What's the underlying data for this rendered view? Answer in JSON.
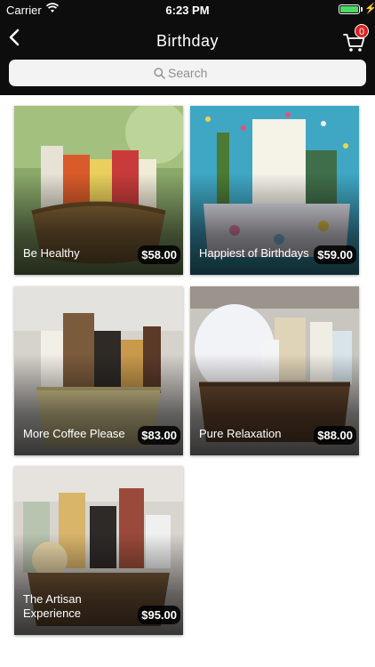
{
  "status_bar": {
    "carrier": "Carrier",
    "time": "6:23 PM",
    "battery_level": 1.0
  },
  "nav": {
    "title": "Birthday",
    "cart_count": "0"
  },
  "search": {
    "placeholder": "Search"
  },
  "colors": {
    "header_bg": "#0d0d0d",
    "badge": "#e02020",
    "battery": "#4cd964"
  },
  "products": [
    {
      "name": "Be Healthy",
      "price": "$58.00"
    },
    {
      "name": "Happiest of Birthdays",
      "price": "$59.00"
    },
    {
      "name": "More Coffee Please",
      "price": "$83.00"
    },
    {
      "name": "Pure Relaxation",
      "price": "$88.00"
    },
    {
      "name": "The Artisan Experience",
      "price": "$95.00"
    }
  ]
}
